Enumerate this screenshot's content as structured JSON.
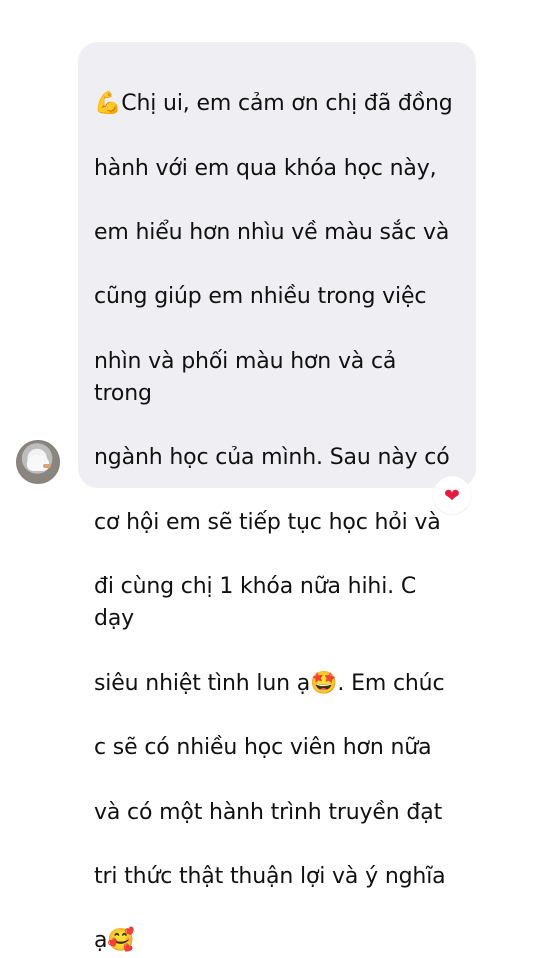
{
  "message": {
    "text_lines": [
      "💪Chị ui, em cảm ơn chị đã đồng",
      "hành với em qua khóa học này,",
      "em hiểu hơn nhìu về màu sắc và",
      "cũng giúp em nhiều trong việc",
      "nhìn và phối màu hơn và cả trong",
      "ngành học của mình. Sau này có",
      "cơ hội em sẽ tiếp tục học hỏi và",
      "đi cùng chị 1 khóa nữa hihi. C dạy",
      "siêu nhiệt tình lun ạ🤩. Em chúc",
      "c sẽ có nhiều học viên hơn nữa",
      "và có một hành trình truyền đạt",
      "tri thức thật thuận lợi và ý nghĩa",
      "ạ🥰"
    ]
  },
  "reaction": {
    "symbol": "❤",
    "color": "#e51b3d"
  },
  "avatar": {
    "icon": "profile-avatar"
  },
  "colors": {
    "bubble_background": "#eeeef3",
    "text": "#111111",
    "page_background": "#ffffff"
  }
}
